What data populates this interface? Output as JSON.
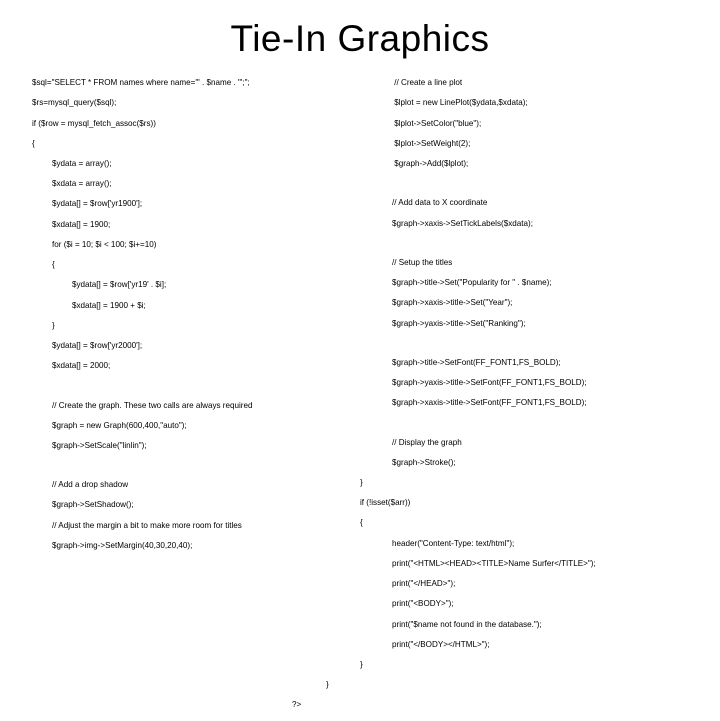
{
  "title": "Tie-In Graphics",
  "left": {
    "l1": "$sql=\"SELECT * FROM names where name='\" . $name . \"';\";",
    "l2": "$rs=mysql_query($sql);",
    "l3": "if ($row = mysql_fetch_assoc($rs))",
    "l4": "{",
    "l5": "$ydata = array();",
    "l6": "$xdata = array();",
    "l7": "$ydata[] = $row['yr1900'];",
    "l8": "$xdata[] = 1900;",
    "l9": "for ($i = 10; $i < 100; $i+=10)",
    "l10": "{",
    "l11": "$ydata[] = $row['yr19' . $i];",
    "l12": "$xdata[] = 1900 + $i;",
    "l13": "}",
    "l14": "$ydata[] = $row['yr2000'];",
    "l15": "$xdata[] = 2000;",
    "l16": "// Create the graph. These two calls are always required",
    "l17": "$graph = new Graph(600,400,\"auto\");",
    "l18": "$graph->SetScale(\"linlin\");",
    "l19": "// Add a drop shadow",
    "l20": "$graph->SetShadow();",
    "l21": "// Adjust the margin a bit to make more room for titles",
    "l22": "$graph->img->SetMargin(40,30,20,40);"
  },
  "right": {
    "r1": " // Create a line plot",
    "r2": " $lplot = new LinePlot($ydata,$xdata);",
    "r3": " $lplot->SetColor(\"blue\");",
    "r4": " $lplot->SetWeight(2);",
    "r5": " $graph->Add($lplot);",
    "r6": "// Add data to X coordinate",
    "r7": "$graph->xaxis->SetTickLabels($xdata);",
    "r8": "// Setup the titles",
    "r9": "$graph->title->Set(\"Popularity for \" . $name);",
    "r10": "$graph->xaxis->title->Set(\"Year\");",
    "r11": "$graph->yaxis->title->Set(\"Ranking\");",
    "r12": "$graph->title->SetFont(FF_FONT1,FS_BOLD);",
    "r13": "$graph->yaxis->title->SetFont(FF_FONT1,FS_BOLD);",
    "r14": "$graph->xaxis->title->SetFont(FF_FONT1,FS_BOLD);",
    "r15": "// Display the graph",
    "r16": "$graph->Stroke();",
    "r17": "}",
    "r18": "if (!isset($arr))",
    "r19": "{",
    "r20": "header(\"Content-Type: text/html\");",
    "r21": "print(\"<HTML><HEAD><TITLE>Name Surfer</TITLE>\");",
    "r22": "print(\"</HEAD>\");",
    "r23": "print(\"<BODY>\");",
    "r24": "print(\"$name not found in the database.\");",
    "r25": "print(\"</BODY></HTML>\");",
    "r26": "}",
    "r27": "}",
    "r28": "?>"
  }
}
